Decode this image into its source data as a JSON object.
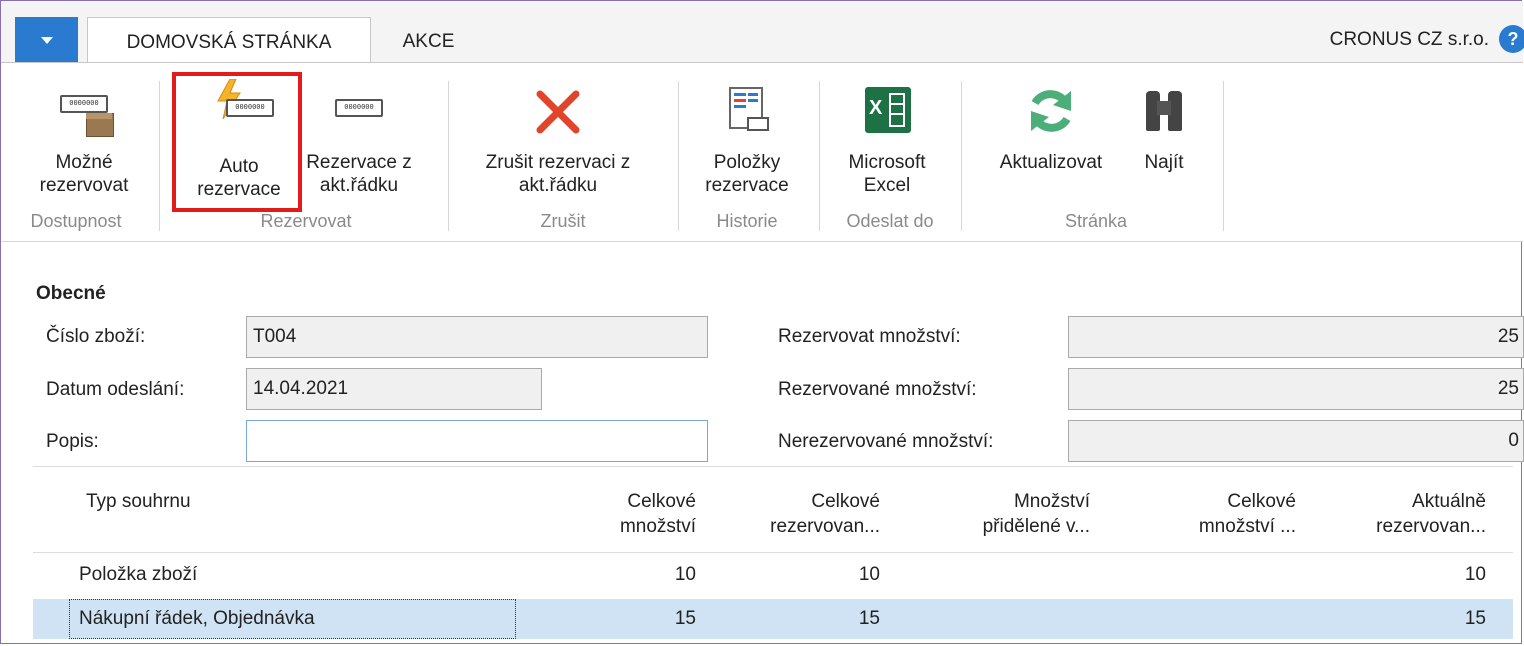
{
  "tabs": [
    {
      "label": "DOMOVSKÁ STRÁNKA",
      "active": true
    },
    {
      "label": "AKCE",
      "active": false
    }
  ],
  "company": "CRONUS CZ s.r.o.",
  "help_icon": "?",
  "ribbon": {
    "buttons": [
      {
        "line1": "Možné",
        "line2": "rezervovat",
        "icon": "available-reservation-icon"
      },
      {
        "line1": "Auto",
        "line2": "rezervace",
        "icon": "auto-reserve-icon"
      },
      {
        "line1": "Rezervace z",
        "line2": "akt.řádku",
        "icon": "reserve-from-line-icon"
      },
      {
        "line1": "Zrušit rezervaci z",
        "line2": "akt.řádku",
        "icon": "cancel-x-icon"
      },
      {
        "line1": "Položky",
        "line2": "rezervace",
        "icon": "reservation-entries-icon"
      },
      {
        "line1": "Microsoft",
        "line2": "Excel",
        "icon": "excel-icon"
      },
      {
        "line1": "Aktualizovat",
        "line2": "",
        "icon": "refresh-icon"
      },
      {
        "line1": "Najít",
        "line2": "",
        "icon": "binoculars-icon"
      }
    ],
    "groups": [
      "Dostupnost",
      "Rezervovat",
      "Zrušit",
      "Historie",
      "Odeslat do",
      "Stránka"
    ],
    "barcode_text": "0000000"
  },
  "form": {
    "section_title": "Obecné",
    "item_no_label": "Číslo zboží:",
    "item_no_value": "T004",
    "ship_date_label": "Datum odeslání:",
    "ship_date_value": "14.04.2021",
    "description_label": "Popis:",
    "description_value": "",
    "reserve_qty_label": "Rezervovat množství:",
    "reserve_qty_value": "25",
    "reserved_qty_label": "Rezervované množství:",
    "reserved_qty_value": "25",
    "unreserved_qty_label": "Nerezervované množství:",
    "unreserved_qty_value": "0"
  },
  "grid": {
    "headers": [
      {
        "l1": "Typ souhrnu",
        "l2": ""
      },
      {
        "l1": "Celkové",
        "l2": "množství"
      },
      {
        "l1": "Celkové",
        "l2": "rezervovan..."
      },
      {
        "l1": "Množství",
        "l2": "přidělené v..."
      },
      {
        "l1": "Celkové",
        "l2": "množství ..."
      },
      {
        "l1": "Aktuálně",
        "l2": "rezervovan..."
      }
    ],
    "rows": [
      {
        "type": "Položka zboží",
        "total_qty": "10",
        "total_reserved": "10",
        "qty_allocated": "",
        "total_qty2": "",
        "current_reserved": "10"
      },
      {
        "type": "Nákupní řádek, Objednávka",
        "total_qty": "15",
        "total_reserved": "15",
        "qty_allocated": "",
        "total_qty2": "",
        "current_reserved": "15"
      }
    ],
    "selected_row": 1
  },
  "colors": {
    "accent": "#2a7ad0",
    "highlight_box": "#e41b1b",
    "selected_row": "#cfe3f4",
    "excel_green": "#1e7145",
    "cancel_red": "#e0442a",
    "refresh_green": "#4caf7a"
  }
}
